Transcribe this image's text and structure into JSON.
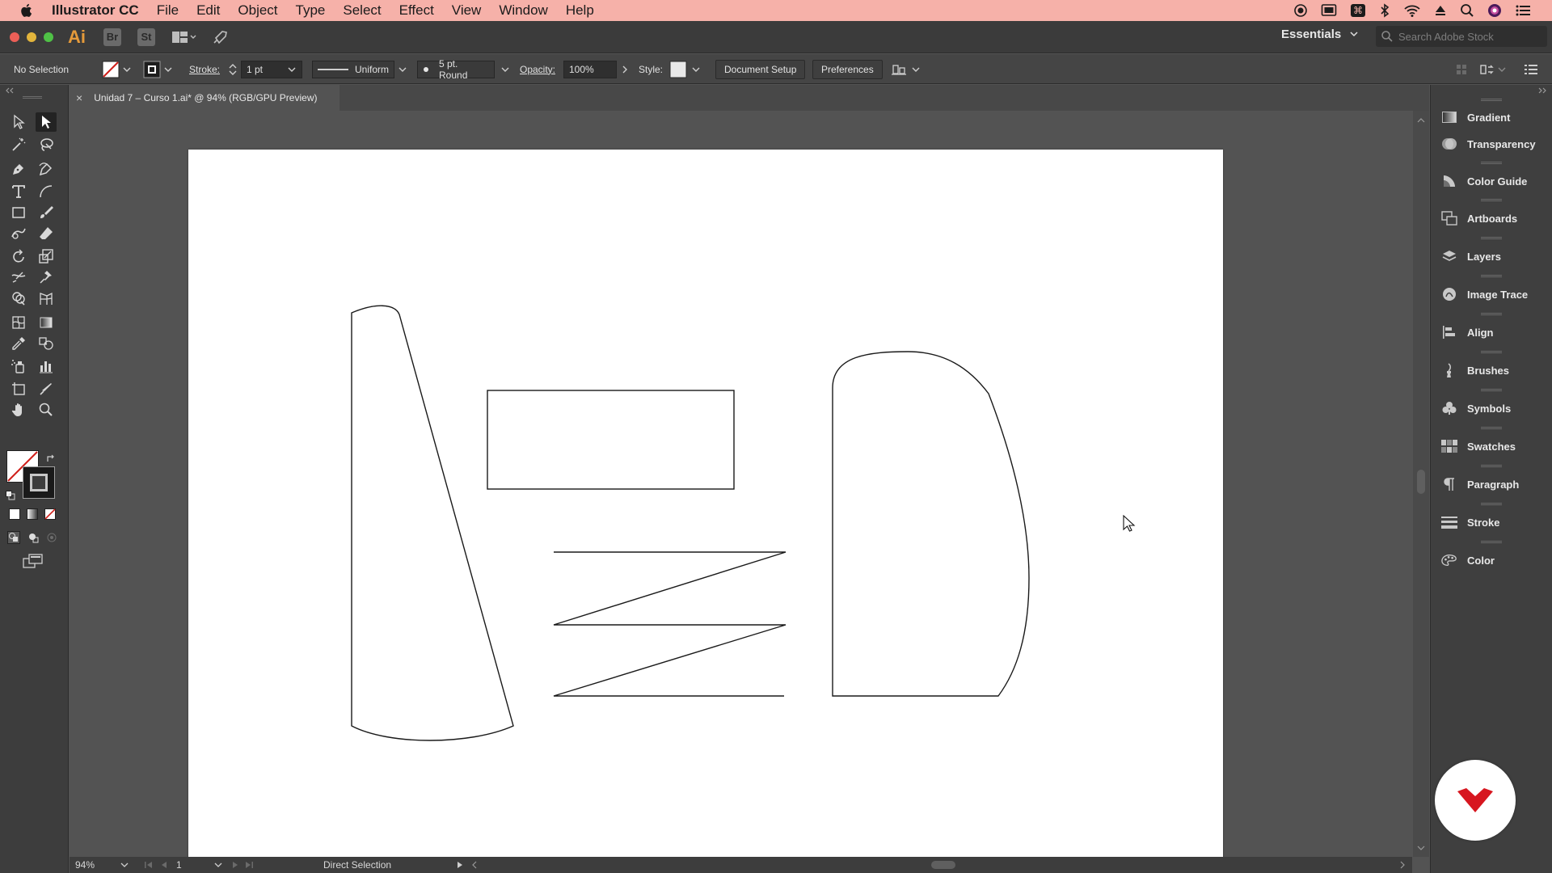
{
  "menubar": {
    "app_name": "Illustrator CC",
    "items": [
      "File",
      "Edit",
      "Object",
      "Type",
      "Select",
      "Effect",
      "View",
      "Window",
      "Help"
    ]
  },
  "appbar": {
    "logo": "Ai",
    "bridge": "Br",
    "stock": "St",
    "workspace": "Essentials",
    "search_placeholder": "Search Adobe Stock"
  },
  "control": {
    "selection": "No Selection",
    "stroke_label": "Stroke:",
    "stroke_weight": "1 pt",
    "profile": "Uniform",
    "brush": "5 pt. Round",
    "opacity_label": "Opacity:",
    "opacity_value": "100%",
    "style_label": "Style:",
    "document_setup": "Document Setup",
    "preferences": "Preferences"
  },
  "tab": {
    "close": "×",
    "title": "Unidad 7 – Curso 1.ai* @ 94% (RGB/GPU Preview)"
  },
  "panels": [
    {
      "label": "Gradient",
      "icon": "gradient-icon"
    },
    {
      "label": "Transparency",
      "icon": "transparency-icon"
    },
    {
      "label": "Color Guide",
      "icon": "color-guide-icon"
    },
    {
      "label": "Artboards",
      "icon": "artboards-icon"
    },
    {
      "label": "Layers",
      "icon": "layers-icon"
    },
    {
      "label": "Image Trace",
      "icon": "image-trace-icon"
    },
    {
      "label": "Align",
      "icon": "align-icon"
    },
    {
      "label": "Brushes",
      "icon": "brushes-icon"
    },
    {
      "label": "Symbols",
      "icon": "symbols-icon"
    },
    {
      "label": "Swatches",
      "icon": "swatches-icon"
    },
    {
      "label": "Paragraph",
      "icon": "paragraph-icon"
    },
    {
      "label": "Stroke",
      "icon": "stroke-icon"
    },
    {
      "label": "Color",
      "icon": "color-icon"
    }
  ],
  "status": {
    "zoom": "94%",
    "artboard_number": "1",
    "tool": "Direct Selection"
  },
  "colors": {
    "menubar_bg": "#f6b1a9",
    "ai_orange": "#e59a3a",
    "none_red": "#d0201b",
    "logo_red": "#d7161f"
  }
}
